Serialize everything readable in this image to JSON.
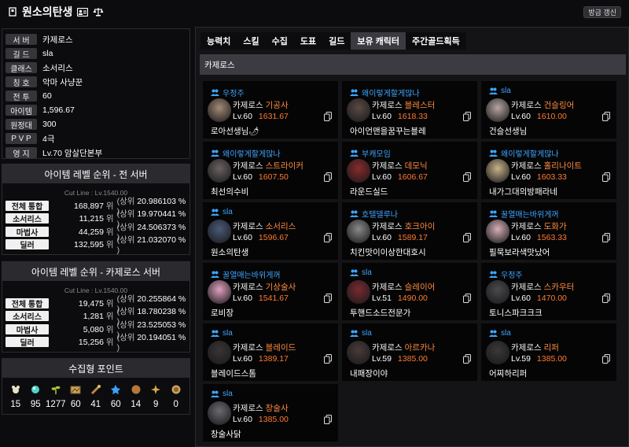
{
  "header": {
    "title": "원소의탄생",
    "refresh_label": "방금 갱신"
  },
  "info": [
    {
      "label": "서 버",
      "value": "카제로스"
    },
    {
      "label": "길 드",
      "value": "sla"
    },
    {
      "label": "클래스",
      "value": "소서리스"
    },
    {
      "label": "칭 호",
      "value": "악마 사냥꾼"
    },
    {
      "label": "전 투",
      "value": "60"
    },
    {
      "label": "아이템",
      "value": "1,596.67"
    },
    {
      "label": "원정대",
      "value": "300"
    },
    {
      "label": "P V P",
      "value": "4극"
    },
    {
      "label": "영 지",
      "value": "Lv.70 암살단본부"
    }
  ],
  "rank_all": {
    "title": "아이템 레벨 순위 - 전 서버",
    "cutline": "Cut Line : Lv.1540.00",
    "rows": [
      {
        "label": "전체 통합",
        "rank": "168,897",
        "unit": "위",
        "pct": "20.986103 %"
      },
      {
        "label": "소서리스",
        "rank": "11,215",
        "unit": "위",
        "pct": "19.970441 %"
      },
      {
        "label": "마법사",
        "rank": "44,259",
        "unit": "위",
        "pct": "24.506373 %"
      },
      {
        "label": "딜러",
        "rank": "132,595",
        "unit": "위",
        "pct": "21.032070 %"
      }
    ]
  },
  "rank_server": {
    "title": "아이템 레벨 순위 - 카제로스 서버",
    "cutline": "Cut Line : Lv.1540.00",
    "rows": [
      {
        "label": "전체 통합",
        "rank": "19,475",
        "unit": "위",
        "pct": "20.255864 %"
      },
      {
        "label": "소서리스",
        "rank": "1,281",
        "unit": "위",
        "pct": "18.780238 %"
      },
      {
        "label": "마법사",
        "rank": "5,080",
        "unit": "위",
        "pct": "23.525053 %"
      },
      {
        "label": "딜러",
        "rank": "15,256",
        "unit": "위",
        "pct": "20.194051 %"
      }
    ]
  },
  "pct_prefix": "(상위",
  "pct_suffix": ")",
  "collect": {
    "title": "수집형 포인트",
    "items": [
      {
        "icon": "mokoko-seed-icon",
        "color": "#e8e0c8",
        "value": "15"
      },
      {
        "icon": "island-soul-icon",
        "color": "#4fd2c8",
        "value": "95"
      },
      {
        "icon": "sprout-icon",
        "color": "#a6c43c",
        "value": "1277"
      },
      {
        "icon": "art-painting-icon",
        "color": "#c9a25a",
        "value": "60"
      },
      {
        "icon": "voyage-item-icon",
        "color": "#c08a3a",
        "value": "41"
      },
      {
        "icon": "world-tree-leaf-icon",
        "color": "#3ba0ff",
        "value": "60"
      },
      {
        "icon": "ignea-token-icon",
        "color": "#b07a3c",
        "value": "14"
      },
      {
        "icon": "orpheus-star-icon",
        "color": "#d8a848",
        "value": "9"
      },
      {
        "icon": "gienah-medal-icon",
        "color": "#c8a060",
        "value": "0"
      }
    ]
  },
  "tabs": [
    "능력치",
    "스킬",
    "수집",
    "도표",
    "길드",
    "보유 캐릭터",
    "주간골드획득"
  ],
  "active_tab": 5,
  "server_bar": "카제로스",
  "characters": [
    {
      "guild": "우정주",
      "server": "카제로스",
      "job": "기공사",
      "lv": "Lv.60",
      "ilvl": "1631.67",
      "name": "로아선생님🌶",
      "avatar": "#a58a76"
    },
    {
      "guild": "왜이렇게할게많나",
      "server": "카제로스",
      "job": "블레스터",
      "lv": "Lv.60",
      "ilvl": "1618.33",
      "name": "아이언맨을꿈꾸는블레",
      "avatar": "#5a4a44"
    },
    {
      "guild": "sla",
      "server": "카제로스",
      "job": "건슬링어",
      "lv": "Lv.60",
      "ilvl": "1610.00",
      "name": "건슬선생님",
      "avatar": "#b6a6a0"
    },
    {
      "guild": "왜이렇게할게많나",
      "server": "카제로스",
      "job": "스트라이커",
      "lv": "Lv.60",
      "ilvl": "1607.50",
      "name": "최선의수비",
      "avatar": "#6a6260"
    },
    {
      "guild": "부캐모임",
      "server": "카제로스",
      "job": "데모닉",
      "lv": "Lv.60",
      "ilvl": "1606.67",
      "name": "라운드실드",
      "avatar": "#8a2a2a"
    },
    {
      "guild": "왜이렇게할게많나",
      "server": "카제로스",
      "job": "홀리나이트",
      "lv": "Lv.60",
      "ilvl": "1603.33",
      "name": "내가그대의방패라네",
      "avatar": "#c8b48a"
    },
    {
      "guild": "sla",
      "server": "카제로스",
      "job": "소서리스",
      "lv": "Lv.60",
      "ilvl": "1596.67",
      "name": "원소의탄생",
      "avatar": "#4a5a78"
    },
    {
      "guild": "호텔델루나",
      "server": "카제로스",
      "job": "호크아이",
      "lv": "Lv.60",
      "ilvl": "1589.17",
      "name": "치킨맛이이상한대호시",
      "avatar": "#8a8a8a"
    },
    {
      "guild": "꿀열매는바위게꺼",
      "server": "카제로스",
      "job": "도화가",
      "lv": "Lv.60",
      "ilvl": "1563.33",
      "name": "필묵보라색맛났어",
      "avatar": "#d6b0b8"
    },
    {
      "guild": "꿀열매는바위게꺼",
      "server": "카제로스",
      "job": "기상술사",
      "lv": "Lv.60",
      "ilvl": "1541.67",
      "name": "로비장",
      "avatar": "#e2a0c0"
    },
    {
      "guild": "sla",
      "server": "카제로스",
      "job": "슬레이어",
      "lv": "Lv.51",
      "ilvl": "1490.00",
      "name": "투핸드소드전문가",
      "avatar": "#7a2a30"
    },
    {
      "guild": "우정주",
      "server": "카제로스",
      "job": "스카우터",
      "lv": "Lv.60",
      "ilvl": "1470.00",
      "name": "토니스파크크크",
      "avatar": "#4a4a4e"
    },
    {
      "guild": "sla",
      "server": "카제로스",
      "job": "블레이드",
      "lv": "Lv.60",
      "ilvl": "1389.17",
      "name": "블레이드스톰",
      "avatar": "#3a3434"
    },
    {
      "guild": "sla",
      "server": "카제로스",
      "job": "아르카나",
      "lv": "Lv.59",
      "ilvl": "1385.00",
      "name": "내패장이야",
      "avatar": "#4a3a3a"
    },
    {
      "guild": "sla",
      "server": "카제로스",
      "job": "리퍼",
      "lv": "Lv.59",
      "ilvl": "1385.00",
      "name": "어찌하리퍼",
      "avatar": "#3a3838"
    },
    {
      "guild": "sla",
      "server": "카제로스",
      "job": "창술사",
      "lv": "Lv.60",
      "ilvl": "1385.00",
      "name": "창술사닭",
      "avatar": "#6a6a70"
    }
  ]
}
